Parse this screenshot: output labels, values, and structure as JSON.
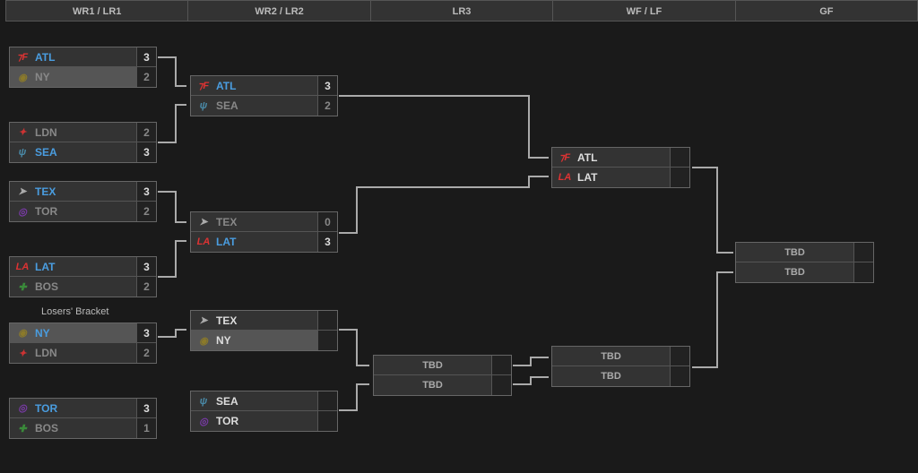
{
  "headers": [
    "WR1 / LR1",
    "WR2 / LR2",
    "LR3",
    "WF / LF",
    "GF"
  ],
  "losers_label": "Losers' Bracket",
  "tbd_text": "TBD",
  "teams": {
    "ATL": {
      "code": "ATL",
      "logo": "⁊F",
      "logo_color": "#d33"
    },
    "NY": {
      "code": "NY",
      "logo": "◉",
      "logo_color": "#8b7a2a"
    },
    "LDN": {
      "code": "LDN",
      "logo": "✦",
      "logo_color": "#c33"
    },
    "SEA": {
      "code": "SEA",
      "logo": "ψ",
      "logo_color": "#4a8aa8"
    },
    "TEX": {
      "code": "TEX",
      "logo": "➤",
      "logo_color": "#aaa"
    },
    "TOR": {
      "code": "TOR",
      "logo": "◎",
      "logo_color": "#7a3aa8"
    },
    "LAT": {
      "code": "LAT",
      "logo": "LA",
      "logo_color": "#d33"
    },
    "BOS": {
      "code": "BOS",
      "logo": "✚",
      "logo_color": "#3a8a3a"
    }
  },
  "matches": {
    "wr1_1": {
      "t1": "ATL",
      "s1": "3",
      "t2": "NY",
      "s2": "2",
      "w": 1,
      "elim": 2
    },
    "wr1_2": {
      "t1": "LDN",
      "s1": "2",
      "t2": "SEA",
      "s2": "3",
      "w": 2,
      "elim": 0
    },
    "wr1_3": {
      "t1": "TEX",
      "s1": "3",
      "t2": "TOR",
      "s2": "2",
      "w": 1,
      "elim": 0
    },
    "wr1_4": {
      "t1": "LAT",
      "s1": "3",
      "t2": "BOS",
      "s2": "2",
      "w": 1,
      "elim": 0
    },
    "lr1_1": {
      "t1": "NY",
      "s1": "3",
      "t2": "LDN",
      "s2": "2",
      "w": 1,
      "elim": 0
    },
    "lr1_2": {
      "t1": "TOR",
      "s1": "3",
      "t2": "BOS",
      "s2": "1",
      "w": 1,
      "elim": 0
    },
    "wr2_1": {
      "t1": "ATL",
      "s1": "3",
      "t2": "SEA",
      "s2": "2",
      "w": 1,
      "elim": 0
    },
    "wr2_2": {
      "t1": "TEX",
      "s1": "0",
      "t2": "LAT",
      "s2": "3",
      "w": 2,
      "elim": 0
    },
    "lr2_1": {
      "t1": "TEX",
      "s1": "",
      "t2": "NY",
      "s2": "",
      "w": 0,
      "elim_row2": true
    },
    "lr2_2": {
      "t1": "SEA",
      "s1": "",
      "t2": "TOR",
      "s2": "",
      "w": 0
    },
    "wf": {
      "t1": "ATL",
      "s1": "",
      "t2": "LAT",
      "s2": "",
      "w": 0
    }
  }
}
